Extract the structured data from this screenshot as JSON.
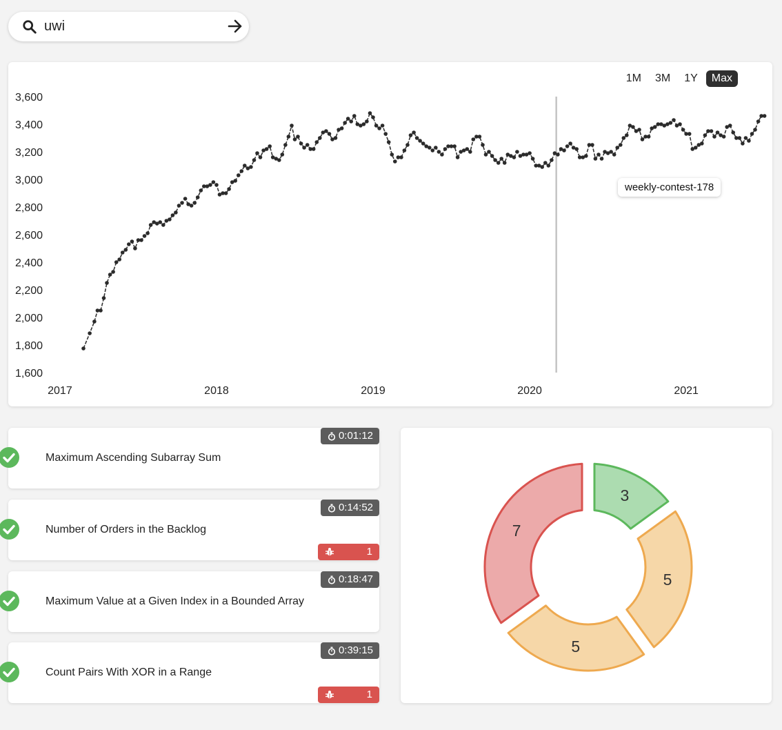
{
  "search": {
    "value": "uwi",
    "placeholder": ""
  },
  "ranges": [
    "1M",
    "3M",
    "1Y",
    "Max"
  ],
  "active_range": "Max",
  "tooltip": "weekly-contest-178",
  "chart_data": {
    "type": "line",
    "title": "",
    "xlabel": "",
    "ylabel": "",
    "ylim": [
      1600,
      3600
    ],
    "yticks": [
      "1,600",
      "1,800",
      "2,000",
      "2,200",
      "2,400",
      "2,600",
      "2,800",
      "3,000",
      "3,200",
      "3,400",
      "3,600"
    ],
    "xticks": [
      "2017",
      "2018",
      "2019",
      "2020",
      "2021"
    ],
    "xlim": [
      2016.67,
      2021.55
    ],
    "crosshair_x": 2020.17,
    "series": [
      {
        "values": [
          [
            2017.15,
            1775
          ],
          [
            2017.19,
            1885
          ],
          [
            2017.22,
            1970
          ],
          [
            2017.24,
            2050
          ],
          [
            2017.26,
            2050
          ],
          [
            2017.28,
            2140
          ],
          [
            2017.3,
            2250
          ],
          [
            2017.32,
            2310
          ],
          [
            2017.34,
            2330
          ],
          [
            2017.36,
            2400
          ],
          [
            2017.38,
            2420
          ],
          [
            2017.4,
            2470
          ],
          [
            2017.42,
            2490
          ],
          [
            2017.44,
            2530
          ],
          [
            2017.46,
            2550
          ],
          [
            2017.48,
            2500
          ],
          [
            2017.5,
            2560
          ],
          [
            2017.52,
            2560
          ],
          [
            2017.54,
            2590
          ],
          [
            2017.56,
            2610
          ],
          [
            2017.58,
            2670
          ],
          [
            2017.6,
            2690
          ],
          [
            2017.62,
            2680
          ],
          [
            2017.64,
            2690
          ],
          [
            2017.66,
            2670
          ],
          [
            2017.68,
            2700
          ],
          [
            2017.7,
            2710
          ],
          [
            2017.72,
            2740
          ],
          [
            2017.74,
            2760
          ],
          [
            2017.76,
            2810
          ],
          [
            2017.78,
            2830
          ],
          [
            2017.8,
            2860
          ],
          [
            2017.82,
            2820
          ],
          [
            2017.84,
            2810
          ],
          [
            2017.86,
            2830
          ],
          [
            2017.88,
            2870
          ],
          [
            2017.9,
            2920
          ],
          [
            2017.92,
            2950
          ],
          [
            2017.94,
            2950
          ],
          [
            2017.96,
            2960
          ],
          [
            2017.98,
            2980
          ],
          [
            2018.0,
            2960
          ],
          [
            2018.02,
            2890
          ],
          [
            2018.04,
            2900
          ],
          [
            2018.06,
            2900
          ],
          [
            2018.08,
            2930
          ],
          [
            2018.1,
            2980
          ],
          [
            2018.12,
            2990
          ],
          [
            2018.14,
            3030
          ],
          [
            2018.16,
            3060
          ],
          [
            2018.18,
            3100
          ],
          [
            2018.2,
            3080
          ],
          [
            2018.22,
            3090
          ],
          [
            2018.24,
            3140
          ],
          [
            2018.26,
            3190
          ],
          [
            2018.28,
            3160
          ],
          [
            2018.3,
            3210
          ],
          [
            2018.32,
            3220
          ],
          [
            2018.34,
            3240
          ],
          [
            2018.36,
            3160
          ],
          [
            2018.38,
            3150
          ],
          [
            2018.4,
            3140
          ],
          [
            2018.42,
            3180
          ],
          [
            2018.44,
            3250
          ],
          [
            2018.46,
            3310
          ],
          [
            2018.48,
            3390
          ],
          [
            2018.5,
            3290
          ],
          [
            2018.52,
            3310
          ],
          [
            2018.54,
            3260
          ],
          [
            2018.56,
            3230
          ],
          [
            2018.58,
            3250
          ],
          [
            2018.6,
            3220
          ],
          [
            2018.62,
            3220
          ],
          [
            2018.64,
            3270
          ],
          [
            2018.66,
            3300
          ],
          [
            2018.68,
            3340
          ],
          [
            2018.7,
            3350
          ],
          [
            2018.72,
            3330
          ],
          [
            2018.74,
            3290
          ],
          [
            2018.76,
            3300
          ],
          [
            2018.78,
            3360
          ],
          [
            2018.8,
            3370
          ],
          [
            2018.82,
            3410
          ],
          [
            2018.84,
            3440
          ],
          [
            2018.86,
            3420
          ],
          [
            2018.88,
            3460
          ],
          [
            2018.9,
            3400
          ],
          [
            2018.92,
            3390
          ],
          [
            2018.94,
            3400
          ],
          [
            2018.96,
            3420
          ],
          [
            2018.98,
            3480
          ],
          [
            2019.0,
            3450
          ],
          [
            2019.02,
            3390
          ],
          [
            2019.04,
            3370
          ],
          [
            2019.06,
            3390
          ],
          [
            2019.08,
            3330
          ],
          [
            2019.1,
            3270
          ],
          [
            2019.12,
            3180
          ],
          [
            2019.14,
            3130
          ],
          [
            2019.16,
            3160
          ],
          [
            2019.18,
            3160
          ],
          [
            2019.2,
            3210
          ],
          [
            2019.22,
            3250
          ],
          [
            2019.24,
            3320
          ],
          [
            2019.26,
            3340
          ],
          [
            2019.28,
            3300
          ],
          [
            2019.3,
            3280
          ],
          [
            2019.32,
            3260
          ],
          [
            2019.34,
            3240
          ],
          [
            2019.36,
            3230
          ],
          [
            2019.38,
            3210
          ],
          [
            2019.4,
            3230
          ],
          [
            2019.42,
            3200
          ],
          [
            2019.44,
            3180
          ],
          [
            2019.46,
            3220
          ],
          [
            2019.48,
            3240
          ],
          [
            2019.5,
            3240
          ],
          [
            2019.52,
            3240
          ],
          [
            2019.54,
            3160
          ],
          [
            2019.56,
            3200
          ],
          [
            2019.58,
            3210
          ],
          [
            2019.6,
            3220
          ],
          [
            2019.62,
            3200
          ],
          [
            2019.64,
            3290
          ],
          [
            2019.66,
            3310
          ],
          [
            2019.68,
            3310
          ],
          [
            2019.7,
            3250
          ],
          [
            2019.72,
            3180
          ],
          [
            2019.74,
            3200
          ],
          [
            2019.76,
            3170
          ],
          [
            2019.78,
            3140
          ],
          [
            2019.8,
            3120
          ],
          [
            2019.82,
            3150
          ],
          [
            2019.84,
            3120
          ],
          [
            2019.86,
            3180
          ],
          [
            2019.88,
            3170
          ],
          [
            2019.9,
            3160
          ],
          [
            2019.92,
            3200
          ],
          [
            2019.94,
            3170
          ],
          [
            2019.96,
            3180
          ],
          [
            2019.98,
            3180
          ],
          [
            2020.0,
            3190
          ],
          [
            2020.02,
            3150
          ],
          [
            2020.04,
            3100
          ],
          [
            2020.06,
            3100
          ],
          [
            2020.08,
            3090
          ],
          [
            2020.1,
            3120
          ],
          [
            2020.12,
            3100
          ],
          [
            2020.14,
            3140
          ],
          [
            2020.16,
            3190
          ],
          [
            2020.18,
            3180
          ],
          [
            2020.2,
            3220
          ],
          [
            2020.22,
            3210
          ],
          [
            2020.24,
            3240
          ],
          [
            2020.26,
            3260
          ],
          [
            2020.28,
            3230
          ],
          [
            2020.3,
            3220
          ],
          [
            2020.32,
            3160
          ],
          [
            2020.34,
            3160
          ],
          [
            2020.36,
            3170
          ],
          [
            2020.38,
            3250
          ],
          [
            2020.4,
            3250
          ],
          [
            2020.42,
            3150
          ],
          [
            2020.44,
            3180
          ],
          [
            2020.46,
            3150
          ],
          [
            2020.48,
            3200
          ],
          [
            2020.5,
            3190
          ],
          [
            2020.52,
            3200
          ],
          [
            2020.54,
            3180
          ],
          [
            2020.56,
            3230
          ],
          [
            2020.58,
            3250
          ],
          [
            2020.6,
            3300
          ],
          [
            2020.62,
            3320
          ],
          [
            2020.64,
            3390
          ],
          [
            2020.66,
            3380
          ],
          [
            2020.68,
            3350
          ],
          [
            2020.7,
            3360
          ],
          [
            2020.72,
            3290
          ],
          [
            2020.74,
            3310
          ],
          [
            2020.76,
            3310
          ],
          [
            2020.78,
            3370
          ],
          [
            2020.8,
            3380
          ],
          [
            2020.82,
            3400
          ],
          [
            2020.84,
            3400
          ],
          [
            2020.86,
            3390
          ],
          [
            2020.88,
            3400
          ],
          [
            2020.9,
            3410
          ],
          [
            2020.92,
            3430
          ],
          [
            2020.94,
            3390
          ],
          [
            2020.96,
            3400
          ],
          [
            2020.98,
            3360
          ],
          [
            2021.0,
            3330
          ],
          [
            2021.02,
            3330
          ],
          [
            2021.04,
            3220
          ],
          [
            2021.06,
            3230
          ],
          [
            2021.08,
            3250
          ],
          [
            2021.1,
            3260
          ],
          [
            2021.12,
            3320
          ],
          [
            2021.14,
            3350
          ],
          [
            2021.16,
            3350
          ],
          [
            2021.18,
            3310
          ],
          [
            2021.2,
            3340
          ],
          [
            2021.22,
            3320
          ],
          [
            2021.24,
            3310
          ],
          [
            2021.26,
            3380
          ],
          [
            2021.28,
            3390
          ],
          [
            2021.3,
            3340
          ],
          [
            2021.32,
            3300
          ],
          [
            2021.34,
            3300
          ],
          [
            2021.36,
            3260
          ],
          [
            2021.38,
            3300
          ],
          [
            2021.4,
            3280
          ],
          [
            2021.42,
            3330
          ],
          [
            2021.44,
            3360
          ],
          [
            2021.46,
            3420
          ],
          [
            2021.48,
            3460
          ],
          [
            2021.5,
            3460
          ]
        ]
      }
    ]
  },
  "problems": [
    {
      "title": "Maximum Ascending Subarray Sum",
      "time": "0:01:12",
      "bugs": ""
    },
    {
      "title": "Number of Orders in the Backlog",
      "time": "0:14:52",
      "bugs": "1"
    },
    {
      "title": "Maximum Value at a Given Index in a Bounded Array",
      "time": "0:18:47",
      "bugs": ""
    },
    {
      "title": "Count Pairs With XOR in a Range",
      "time": "0:39:15",
      "bugs": "1"
    }
  ],
  "donut": {
    "segments": [
      {
        "label": "3",
        "value": 3,
        "fill": "#acdcb0",
        "stroke": "#5cb85c"
      },
      {
        "label": "5",
        "value": 5,
        "fill": "#f6d7a8",
        "stroke": "#eea94f"
      },
      {
        "label": "5",
        "value": 5,
        "fill": "#f6d7a8",
        "stroke": "#eea94f"
      },
      {
        "label": "7",
        "value": 7,
        "fill": "#ecaaaa",
        "stroke": "#d9534f"
      }
    ]
  },
  "colors": {
    "accent_dark": "#2f2f2f",
    "success": "#5cb85c",
    "danger": "#d9534f",
    "timer_bg": "#5c5c5c"
  }
}
